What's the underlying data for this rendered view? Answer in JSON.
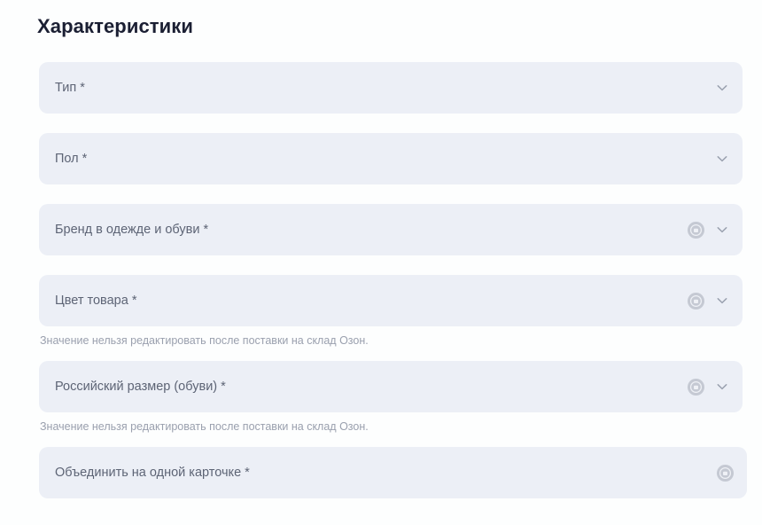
{
  "section": {
    "title": "Характеристики"
  },
  "colors": {
    "page_background": "#fdfefe",
    "field_background": "#eceff6",
    "title_text": "#1b1f33",
    "label_text": "#5d6475",
    "helper_text": "#9aa0ae",
    "icon_gray": "#a8aeba"
  },
  "fields": [
    {
      "label": "Тип *",
      "icons": [
        "chevron-down-icon"
      ],
      "helper": null
    },
    {
      "label": "Пол *",
      "icons": [
        "chevron-down-icon"
      ],
      "helper": null
    },
    {
      "label": "Бренд в одежде и обуви *",
      "icons": [
        "lock-circle-icon",
        "chevron-down-icon"
      ],
      "helper": null
    },
    {
      "label": "Цвет товара *",
      "icons": [
        "lock-circle-icon",
        "chevron-down-icon"
      ],
      "helper": "Значение нельзя редактировать после поставки на склад Озон."
    },
    {
      "label": "Российский размер (обуви) *",
      "icons": [
        "lock-circle-icon",
        "chevron-down-icon"
      ],
      "helper": "Значение нельзя редактировать после поставки на склад Озон."
    },
    {
      "label": "Объединить на одной карточке *",
      "icons": [
        "lock-circle-icon"
      ],
      "helper": null
    }
  ]
}
